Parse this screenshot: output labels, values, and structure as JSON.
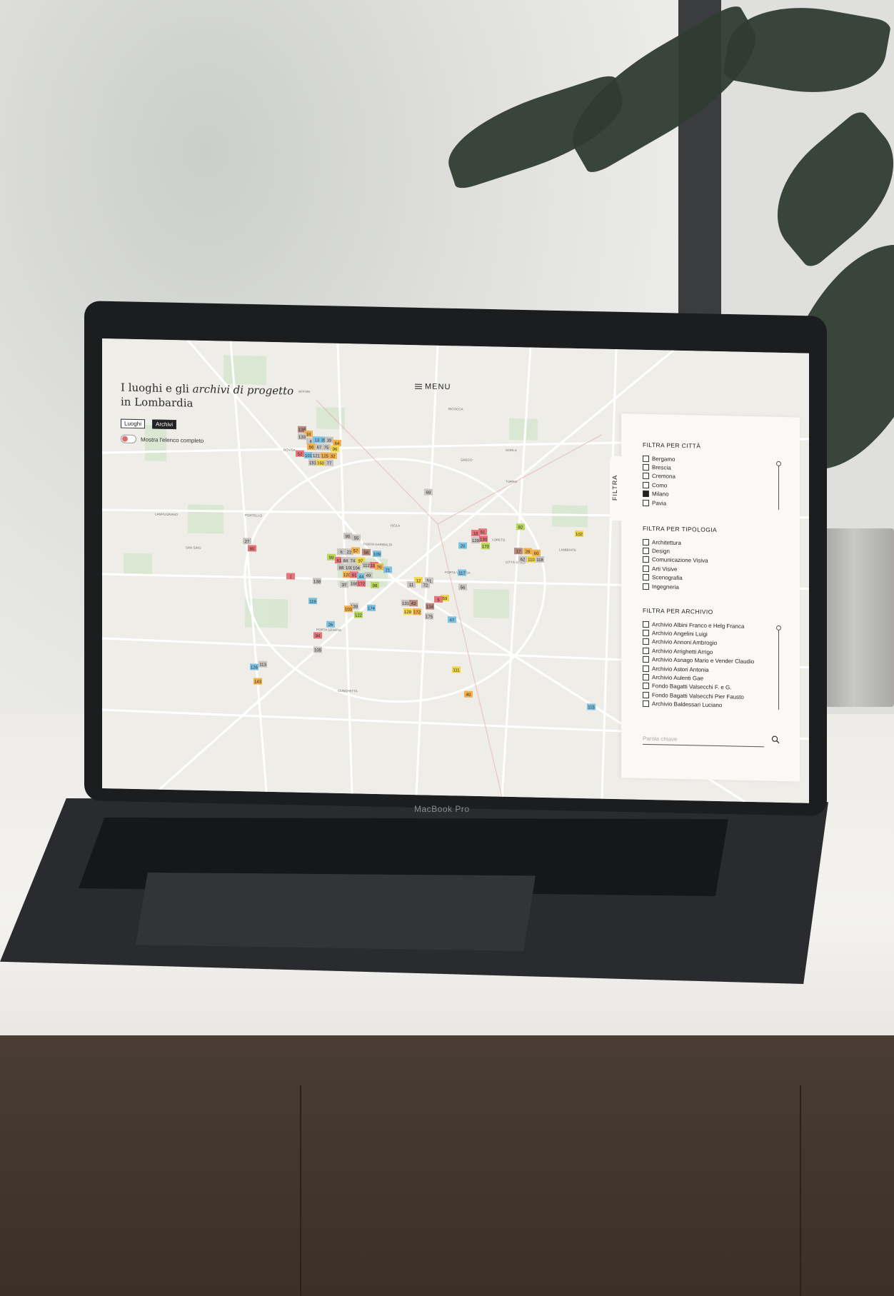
{
  "header": {
    "title_line1_prefix": "I luoghi e gli",
    "title_line1_italic": "archivi di progetto",
    "title_line2": "in Lombardia",
    "menu_label": "MENU"
  },
  "view_toggle": {
    "luoghi": "Luoghi",
    "archivi": "Archivi",
    "active": "Archivi"
  },
  "switch_label": "Mostra l'elenco completo",
  "filter_tab": "FILTRA",
  "filters": {
    "citta": {
      "heading": "FILTRA PER CITTÀ",
      "options": [
        {
          "label": "Bergamo",
          "checked": false
        },
        {
          "label": "Brescia",
          "checked": false
        },
        {
          "label": "Cremona",
          "checked": false
        },
        {
          "label": "Como",
          "checked": false
        },
        {
          "label": "Milano",
          "checked": true
        },
        {
          "label": "Pavia",
          "checked": false
        }
      ]
    },
    "tipologia": {
      "heading": "FILTRA PER TIPOLOGIA",
      "options": [
        {
          "label": "Architettura",
          "checked": false
        },
        {
          "label": "Design",
          "checked": false
        },
        {
          "label": "Comunicazione Visiva",
          "checked": false
        },
        {
          "label": "Arti Visive",
          "checked": false
        },
        {
          "label": "Scenografia",
          "checked": false
        },
        {
          "label": "Ingegneria",
          "checked": false
        }
      ]
    },
    "archivio": {
      "heading": "FILTRA PER ARCHIVIO",
      "options": [
        {
          "label": "Archivio Albini Franco e Helg Franca",
          "checked": false
        },
        {
          "label": "Archivio Angelini Luigi",
          "checked": false
        },
        {
          "label": "Archivio Annoni Ambrogio",
          "checked": false
        },
        {
          "label": "Archivio Arrighetti Arrigo",
          "checked": false
        },
        {
          "label": "Archivio Asnago Mario e Vender Claudio",
          "checked": false
        },
        {
          "label": "Archivio Astori Antonia",
          "checked": false
        },
        {
          "label": "Archivio Aulenti Gae",
          "checked": false
        },
        {
          "label": "Fondo Bagatti Valsecchi F. e G.",
          "checked": false
        },
        {
          "label": "Fondo Bagatti Valsecchi Pier Fausto",
          "checked": false
        },
        {
          "label": "Archivio Baldessari Luciano",
          "checked": false
        }
      ]
    }
  },
  "search": {
    "placeholder": "Parola chiave"
  },
  "laptop_brand": "MacBook Pro",
  "districts": [
    "AFFORI",
    "BICOCCA",
    "GORLA",
    "GRECO",
    "BOVISA",
    "TURRO",
    "LAMPUGNANO",
    "PORTELLO",
    "ISOLA",
    "LORETO",
    "LAMBRATE",
    "SAN SIRO",
    "PORTA GARIBALDI",
    "CITTÀ STUDI",
    "PORTA VENEZIA",
    "PORTA GENOVA",
    "CONCHETTA"
  ],
  "colors": {
    "red": "#e7747a",
    "orange": "#f0b04c",
    "yellow": "#f2d64a",
    "blue": "#7cc3e3",
    "green": "#b7d65b",
    "gray": "#c9c6c1",
    "brown": "#b88a7e"
  },
  "markers": [
    {
      "n": "135",
      "c": "brown"
    },
    {
      "n": "10",
      "c": "orange"
    },
    {
      "n": "133",
      "c": "gray"
    },
    {
      "n": "4",
      "c": "gray"
    },
    {
      "n": "13",
      "c": "blue"
    },
    {
      "n": "35",
      "c": "blue"
    },
    {
      "n": "39",
      "c": "gray"
    },
    {
      "n": "64",
      "c": "orange"
    },
    {
      "n": "56",
      "c": "orange"
    },
    {
      "n": "67",
      "c": "gray"
    },
    {
      "n": "75",
      "c": "gray"
    },
    {
      "n": "96",
      "c": "yellow"
    },
    {
      "n": "52",
      "c": "red"
    },
    {
      "n": "101",
      "c": "blue"
    },
    {
      "n": "121",
      "c": "gray"
    },
    {
      "n": "125",
      "c": "orange"
    },
    {
      "n": "32",
      "c": "orange"
    },
    {
      "n": "151",
      "c": "gray"
    },
    {
      "n": "160",
      "c": "yellow"
    },
    {
      "n": "77",
      "c": "gray"
    },
    {
      "n": "69",
      "c": "gray"
    },
    {
      "n": "92",
      "c": "green"
    },
    {
      "n": "102",
      "c": "yellow"
    },
    {
      "n": "18",
      "c": "red"
    },
    {
      "n": "51",
      "c": "red"
    },
    {
      "n": "129",
      "c": "gray"
    },
    {
      "n": "130",
      "c": "red"
    },
    {
      "n": "170",
      "c": "green"
    },
    {
      "n": "20",
      "c": "blue"
    },
    {
      "n": "17",
      "c": "brown"
    },
    {
      "n": "28",
      "c": "orange"
    },
    {
      "n": "60",
      "c": "orange"
    },
    {
      "n": "62",
      "c": "gray"
    },
    {
      "n": "110",
      "c": "yellow"
    },
    {
      "n": "118",
      "c": "gray"
    },
    {
      "n": "27",
      "c": "gray"
    },
    {
      "n": "80",
      "c": "red"
    },
    {
      "n": "95",
      "c": "gray"
    },
    {
      "n": "55",
      "c": "gray"
    },
    {
      "n": "6",
      "c": "gray"
    },
    {
      "n": "22",
      "c": "gray"
    },
    {
      "n": "57",
      "c": "orange"
    },
    {
      "n": "58",
      "c": "brown"
    },
    {
      "n": "109",
      "c": "blue"
    },
    {
      "n": "99",
      "c": "green"
    },
    {
      "n": "61",
      "c": "red"
    },
    {
      "n": "84",
      "c": "gray"
    },
    {
      "n": "74",
      "c": "gray"
    },
    {
      "n": "97",
      "c": "yellow"
    },
    {
      "n": "112",
      "c": "gray"
    },
    {
      "n": "165",
      "c": "red"
    },
    {
      "n": "70",
      "c": "orange"
    },
    {
      "n": "88",
      "c": "gray"
    },
    {
      "n": "100",
      "c": "gray"
    },
    {
      "n": "104",
      "c": "gray"
    },
    {
      "n": "21",
      "c": "blue"
    },
    {
      "n": "117",
      "c": "blue"
    },
    {
      "n": "120",
      "c": "orange"
    },
    {
      "n": "81",
      "c": "red"
    },
    {
      "n": "44",
      "c": "blue"
    },
    {
      "n": "49",
      "c": "gray"
    },
    {
      "n": "12",
      "c": "yellow"
    },
    {
      "n": "51",
      "c": "gray"
    },
    {
      "n": "1",
      "c": "red"
    },
    {
      "n": "138",
      "c": "gray"
    },
    {
      "n": "37",
      "c": "gray"
    },
    {
      "n": "166",
      "c": "gray"
    },
    {
      "n": "172",
      "c": "red"
    },
    {
      "n": "98",
      "c": "green"
    },
    {
      "n": "11",
      "c": "gray"
    },
    {
      "n": "72",
      "c": "gray"
    },
    {
      "n": "56",
      "c": "gray"
    },
    {
      "n": "59",
      "c": "yellow"
    },
    {
      "n": "5",
      "c": "red"
    },
    {
      "n": "119",
      "c": "blue"
    },
    {
      "n": "139",
      "c": "gray"
    },
    {
      "n": "174",
      "c": "blue"
    },
    {
      "n": "131",
      "c": "gray"
    },
    {
      "n": "43",
      "c": "brown"
    },
    {
      "n": "134",
      "c": "brown"
    },
    {
      "n": "103",
      "c": "orange"
    },
    {
      "n": "122",
      "c": "green"
    },
    {
      "n": "129",
      "c": "yellow"
    },
    {
      "n": "172",
      "c": "orange"
    },
    {
      "n": "175",
      "c": "gray"
    },
    {
      "n": "47",
      "c": "blue"
    },
    {
      "n": "26",
      "c": "blue"
    },
    {
      "n": "94",
      "c": "red"
    },
    {
      "n": "105",
      "c": "gray"
    },
    {
      "n": "126",
      "c": "blue"
    },
    {
      "n": "113",
      "c": "gray"
    },
    {
      "n": "143",
      "c": "orange"
    },
    {
      "n": "111",
      "c": "yellow"
    },
    {
      "n": "40",
      "c": "orange"
    },
    {
      "n": "115",
      "c": "blue"
    },
    {
      "n": "147",
      "c": "red"
    }
  ]
}
